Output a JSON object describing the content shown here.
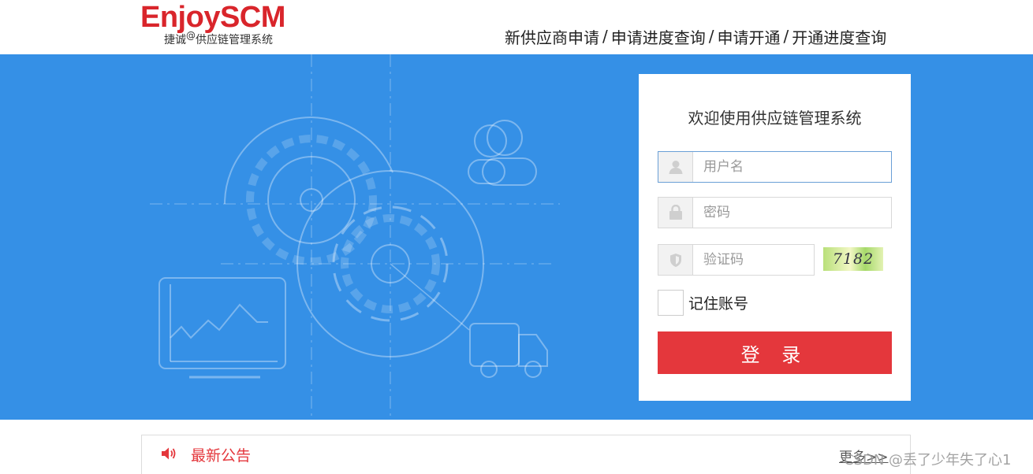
{
  "logo": {
    "main": "EnjoySCM",
    "sub_left": "捷诚",
    "sub_at": "@",
    "sub_right": "供应链管理系统"
  },
  "topnav": {
    "items": [
      "新供应商申请",
      "申请进度查询",
      "申请开通",
      "开通进度查询"
    ],
    "separator": "/"
  },
  "login": {
    "title": "欢迎使用供应链管理系统",
    "username_placeholder": "用户名",
    "password_placeholder": "密码",
    "captcha_placeholder": "验证码",
    "captcha_text": "7182",
    "remember_label": "记住账号",
    "submit_label": "登 录"
  },
  "notice": {
    "title": "最新公告",
    "more": "更多>>"
  },
  "watermark": "CSDN @丢了少年失了心1",
  "colors": {
    "banner": "#3590e6",
    "brand_red": "#d9252b",
    "button_red": "#e4373c"
  },
  "icons": [
    "user-icon",
    "lock-icon",
    "shield-icon",
    "speaker-icon"
  ]
}
